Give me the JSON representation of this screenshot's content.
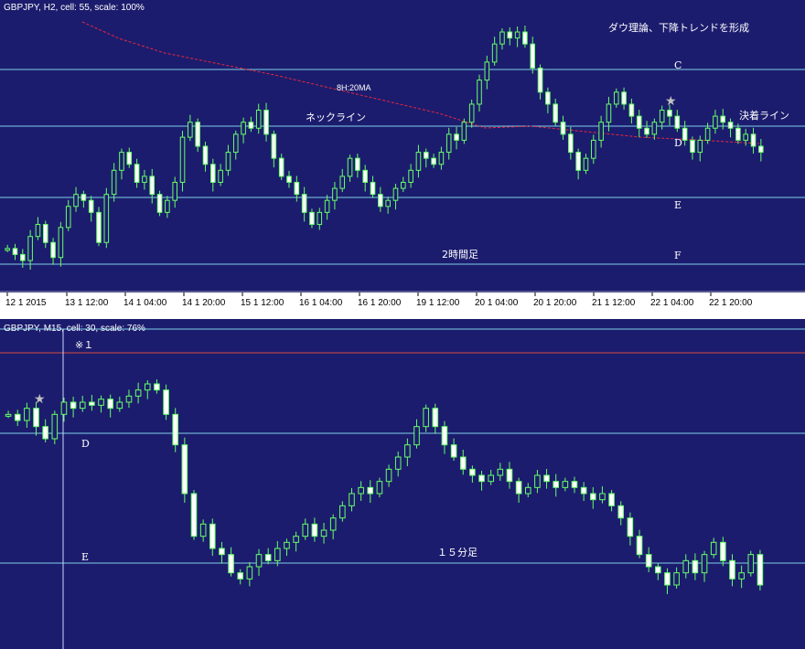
{
  "colors": {
    "background": "#1c1c6e",
    "candle": "#66ff66",
    "hline": "#7ecfe6",
    "ma": "#e8283c",
    "red_line": "#d94a3a",
    "vline": "#c8d8ff",
    "text": "#ffffff"
  },
  "chart_data": [
    {
      "type": "candlestick",
      "title": "GBPJPY, H2, cell: 55, scale: 100%",
      "x_tick_labels": [
        "12 1 2015",
        "13 1 12:00",
        "14 1 04:00",
        "14 1 20:00",
        "15 1 12:00",
        "16 1 04:00",
        "16 1 20:00",
        "19 1 12:00",
        "20 1 04:00",
        "20 1 20:00",
        "21 1 12:00",
        "22 1 04:00",
        "22 1 20:00"
      ],
      "annotations": {
        "trend_note": "ダウ理論、下降トレンドを形成",
        "ma_label": "8H:20MA",
        "neckline_label": "ネックライン",
        "settle_label": "決着ライン",
        "level_c": "C",
        "level_d": "D",
        "level_e": "E",
        "level_f": "F",
        "timeframe_label": "2時間足",
        "star": "★"
      },
      "closes": [
        18,
        16,
        14,
        22,
        26,
        20,
        15,
        25,
        32,
        36,
        34,
        30,
        20,
        36,
        44,
        50,
        46,
        40,
        42,
        36,
        30,
        34,
        40,
        55,
        60,
        52,
        46,
        40,
        44,
        50,
        56,
        60,
        58,
        64,
        56,
        48,
        42,
        40,
        36,
        30,
        26,
        30,
        34,
        38,
        42,
        48,
        44,
        40,
        36,
        32,
        34,
        38,
        40,
        44,
        50,
        48,
        46,
        50,
        56,
        54,
        60,
        66,
        74,
        80,
        86,
        90,
        88,
        90,
        86,
        78,
        70,
        66,
        60,
        56,
        50,
        44,
        48,
        54,
        60,
        66,
        70,
        66,
        62,
        58,
        56,
        60,
        64,
        62,
        58,
        54,
        50,
        54,
        58,
        62,
        60,
        58,
        54,
        56,
        52,
        50
      ]
    },
    {
      "type": "candlestick",
      "title": "GBPJPY, M15, cell: 30, scale: 76%",
      "annotations": {
        "marker": "※１",
        "level_d": "D",
        "level_e": "E",
        "timeframe_label": "１５分足",
        "star": "★"
      },
      "closes": [
        70,
        68,
        72,
        66,
        62,
        70,
        74,
        72,
        74,
        73,
        75,
        72,
        74,
        76,
        78,
        80,
        78,
        70,
        60,
        44,
        30,
        34,
        26,
        24,
        18,
        16,
        20,
        24,
        22,
        26,
        28,
        30,
        34,
        30,
        32,
        36,
        40,
        44,
        46,
        44,
        48,
        52,
        56,
        60,
        66,
        72,
        66,
        60,
        56,
        52,
        50,
        48,
        50,
        52,
        48,
        44,
        46,
        50,
        48,
        46,
        48,
        46,
        44,
        42,
        44,
        40,
        36,
        30,
        24,
        20,
        18,
        14,
        18,
        22,
        18,
        24,
        28,
        22,
        16,
        18,
        24,
        14
      ]
    }
  ]
}
